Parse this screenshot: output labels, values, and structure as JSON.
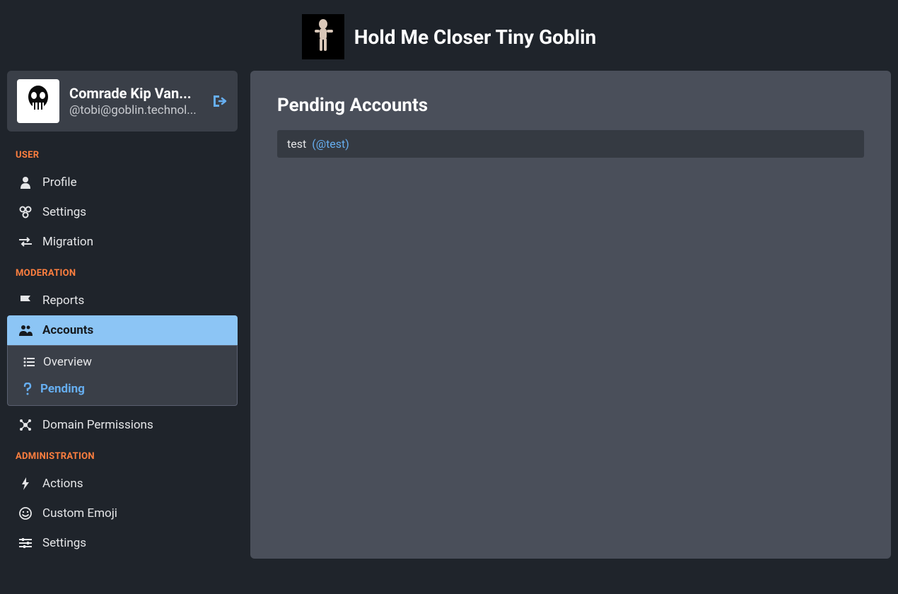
{
  "header": {
    "title": "Hold Me Closer Tiny Goblin"
  },
  "user": {
    "display_name": "Comrade Kip Van...",
    "handle": "@tobi@goblin.technol..."
  },
  "sections": {
    "user": {
      "label": "USER",
      "items": [
        {
          "label": "Profile",
          "icon": "user-icon"
        },
        {
          "label": "Settings",
          "icon": "gear-icon"
        },
        {
          "label": "Migration",
          "icon": "arrows-icon"
        }
      ]
    },
    "moderation": {
      "label": "MODERATION",
      "items": [
        {
          "label": "Reports",
          "icon": "flag-icon"
        },
        {
          "label": "Accounts",
          "icon": "users-icon",
          "active": true,
          "children": [
            {
              "label": "Overview",
              "icon": "list-icon"
            },
            {
              "label": "Pending",
              "icon": "question-icon",
              "selected": true
            }
          ]
        },
        {
          "label": "Domain Permissions",
          "icon": "hub-icon"
        }
      ]
    },
    "administration": {
      "label": "ADMINISTRATION",
      "items": [
        {
          "label": "Actions",
          "icon": "bolt-icon"
        },
        {
          "label": "Custom Emoji",
          "icon": "smile-icon"
        },
        {
          "label": "Settings",
          "icon": "sliders-icon"
        }
      ]
    }
  },
  "main": {
    "title": "Pending Accounts",
    "pending": [
      {
        "display": "test",
        "handle": "(@test)"
      }
    ]
  }
}
